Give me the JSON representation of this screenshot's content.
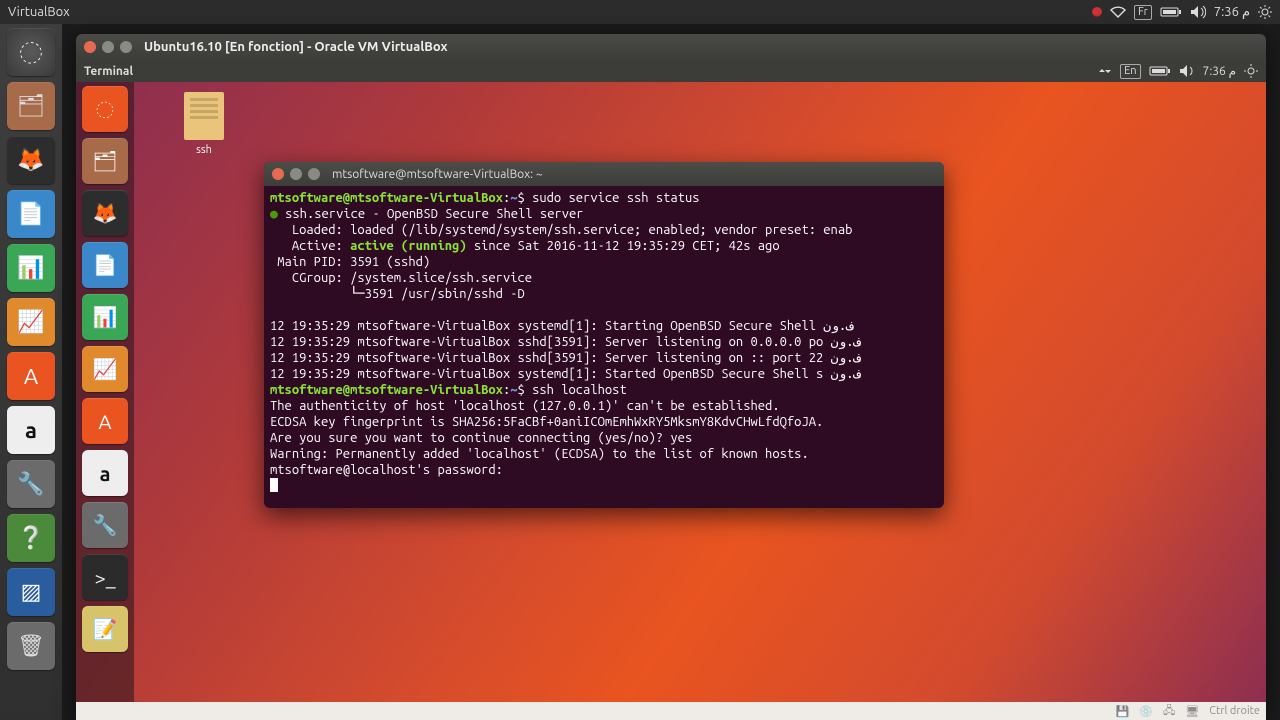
{
  "host_top": {
    "title": "VirtualBox",
    "keyboard": "Fr",
    "time": "7:36 م"
  },
  "vm": {
    "title": "Ubuntu16.10 [En fonction] - Oracle VM VirtualBox",
    "menubar_left": "Terminal",
    "guest_top": {
      "keyboard": "En",
      "time": "7:36 م"
    },
    "desktop_icon": "ssh",
    "status_right": "Ctrl droite"
  },
  "terminal": {
    "title": "mtsoftware@mtsoftware-VirtualBox: ~",
    "prompt_user": "mtsoftware@mtsoftware-VirtualBox",
    "prompt_sep": ":",
    "prompt_path": "~",
    "prompt_dollar": "$ ",
    "lines": {
      "cmd1": "sudo service ssh status",
      "l1": " ssh.service - OpenBSD Secure Shell server",
      "l2": "   Loaded: loaded (/lib/systemd/system/ssh.service; enabled; vendor preset: enab",
      "l3a": "   Active: ",
      "l3b": "active (running)",
      "l3c": " since Sat 2016-11-12 19:35:29 CET; 42s ago",
      "l4": " Main PID: 3591 (sshd)",
      "l5": "   CGroup: /system.slice/ssh.service",
      "l6": "           └─3591 /usr/sbin/sshd -D",
      "blank": "",
      "l7": "12 19:35:29 mtsoftware-VirtualBox systemd[1]: Starting OpenBSD Secure Shell ف.ون",
      "l8": "12 19:35:29 mtsoftware-VirtualBox sshd[3591]: Server listening on 0.0.0.0 po ف.ون",
      "l9": "12 19:35:29 mtsoftware-VirtualBox sshd[3591]: Server listening on :: port 22 ف.ون",
      "l10": "12 19:35:29 mtsoftware-VirtualBox systemd[1]: Started OpenBSD Secure Shell s ف.ون",
      "cmd2": "ssh localhost",
      "l11": "The authenticity of host 'localhost (127.0.0.1)' can't be established.",
      "l12": "ECDSA key fingerprint is SHA256:5FaCBf+0aniICOmEmhWxRY5MksmY8KdvCHwLfdQfoJA.",
      "l13": "Are you sure you want to continue connecting (yes/no)? yes",
      "l14": "Warning: Permanently added 'localhost' (ECDSA) to the list of known hosts.",
      "l15": "mtsoftware@localhost's password:"
    }
  },
  "host_launcher": [
    "ubuntu",
    "files",
    "firefox",
    "doc",
    "calc",
    "impress",
    "software",
    "amazon",
    "settings",
    "help",
    "vbox",
    "trash"
  ],
  "guest_launcher": [
    "ubuntu",
    "files",
    "firefox",
    "doc",
    "calc",
    "impress",
    "software",
    "amazon",
    "settings",
    "term",
    "gedit"
  ]
}
